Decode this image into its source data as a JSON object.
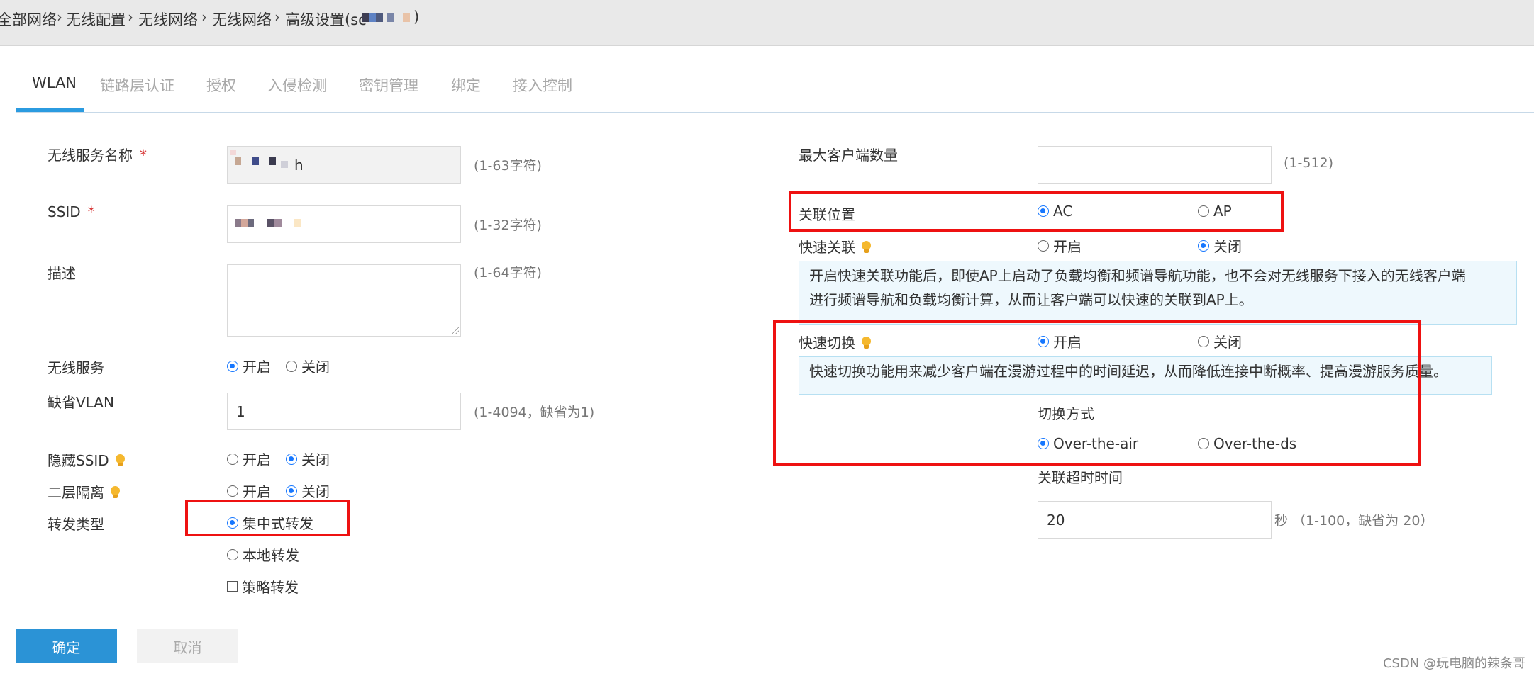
{
  "breadcrumb": {
    "items": [
      "全部网络",
      "无线配置",
      "无线网络",
      "无线网络",
      "高级设置(sc"
    ],
    "tail": ")"
  },
  "tabs": [
    {
      "label": "WLAN",
      "active": true
    },
    {
      "label": "链路层认证"
    },
    {
      "label": "授权"
    },
    {
      "label": "入侵检测"
    },
    {
      "label": "密钥管理"
    },
    {
      "label": "绑定"
    },
    {
      "label": "接入控制"
    }
  ],
  "left": {
    "service_name": {
      "label": "无线服务名称",
      "required": "*",
      "value": "h",
      "hint": "(1-63字符)"
    },
    "ssid": {
      "label": "SSID",
      "required": "*",
      "hint": "(1-32字符)"
    },
    "description": {
      "label": "描述",
      "hint": "(1-64字符)"
    },
    "wireless_service": {
      "label": "无线服务",
      "on": "开启",
      "off": "关闭",
      "selected": "on"
    },
    "default_vlan": {
      "label": "缺省VLAN",
      "value": "1",
      "hint": "(1-4094，缺省为1)"
    },
    "hide_ssid": {
      "label": "隐藏SSID",
      "on": "开启",
      "off": "关闭",
      "selected": "off"
    },
    "l2_isolation": {
      "label": "二层隔离",
      "on": "开启",
      "off": "关闭",
      "selected": "off"
    },
    "forward_type": {
      "label": "转发类型",
      "central": "集中式转发",
      "local": "本地转发",
      "policy": "策略转发",
      "selected": "central"
    }
  },
  "right": {
    "max_clients": {
      "label": "最大客户端数量",
      "value": "",
      "hint": "(1-512)"
    },
    "assoc_location": {
      "label": "关联位置",
      "ac": "AC",
      "ap": "AP",
      "selected": "ac"
    },
    "fast_assoc": {
      "label": "快速关联",
      "on": "开启",
      "off": "关闭",
      "selected": "off",
      "info_line1": "开启快速关联功能后，即使AP上启动了负载均衡和频谱导航功能，也不会对无线服务下接入的无线客户端",
      "info_line2": "进行频谱导航和负载均衡计算，从而让客户端可以快速的关联到AP上。"
    },
    "fast_roam": {
      "label": "快速切换",
      "on": "开启",
      "off": "关闭",
      "selected": "on",
      "info": "快速切换功能用来减少客户端在漫游过程中的时间延迟，从而降低连接中断概率、提高漫游服务质量。",
      "mode_label": "切换方式",
      "mode_air": "Over-the-air",
      "mode_ds": "Over-the-ds",
      "mode_selected": "air"
    },
    "assoc_timeout": {
      "label": "关联超时时间",
      "value": "20",
      "hint": "秒 （1-100，缺省为 20）"
    }
  },
  "buttons": {
    "ok": "确定",
    "cancel": "取消"
  },
  "watermark": "CSDN @玩电脑的辣条哥",
  "colors": {
    "accent": "#2b93d6",
    "highlight_box": "#ee1111",
    "radio_on": "#1677ff"
  }
}
